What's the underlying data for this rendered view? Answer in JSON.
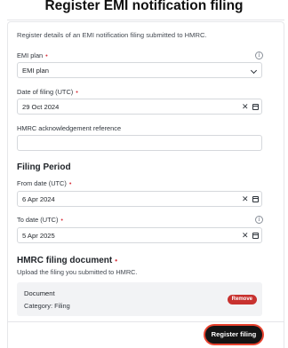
{
  "page": {
    "title": "Register EMI notification filing",
    "intro": "Register details of an EMI notification filing submitted to HMRC."
  },
  "fields": {
    "emi_plan": {
      "label": "EMI plan",
      "value": "EMI plan"
    },
    "date_of_filing": {
      "label": "Date of filing (UTC)",
      "value": "29 Oct 2024"
    },
    "hmrc_reference": {
      "label": "HMRC acknowledgement reference",
      "value": ""
    }
  },
  "filing_period": {
    "heading": "Filing Period",
    "from": {
      "label": "From date (UTC)",
      "value": "6 Apr 2024"
    },
    "to": {
      "label": "To date (UTC)",
      "value": "5 Apr 2025"
    }
  },
  "document": {
    "heading": "HMRC filing document",
    "subtext": "Upload the filing you submitted to HMRC.",
    "card_title": "Document",
    "card_category": "Category: Filing",
    "remove_label": "Remove"
  },
  "actions": {
    "submit_label": "Register filing"
  },
  "colors": {
    "required": "#d93640",
    "remove": "#c8322f",
    "primary": "#141414",
    "focus_ring": "#e8422f"
  },
  "icons": {
    "info": "info-icon",
    "clear": "clear-icon",
    "calendar": "calendar-icon",
    "dropdown": "chevron-down-icon"
  }
}
